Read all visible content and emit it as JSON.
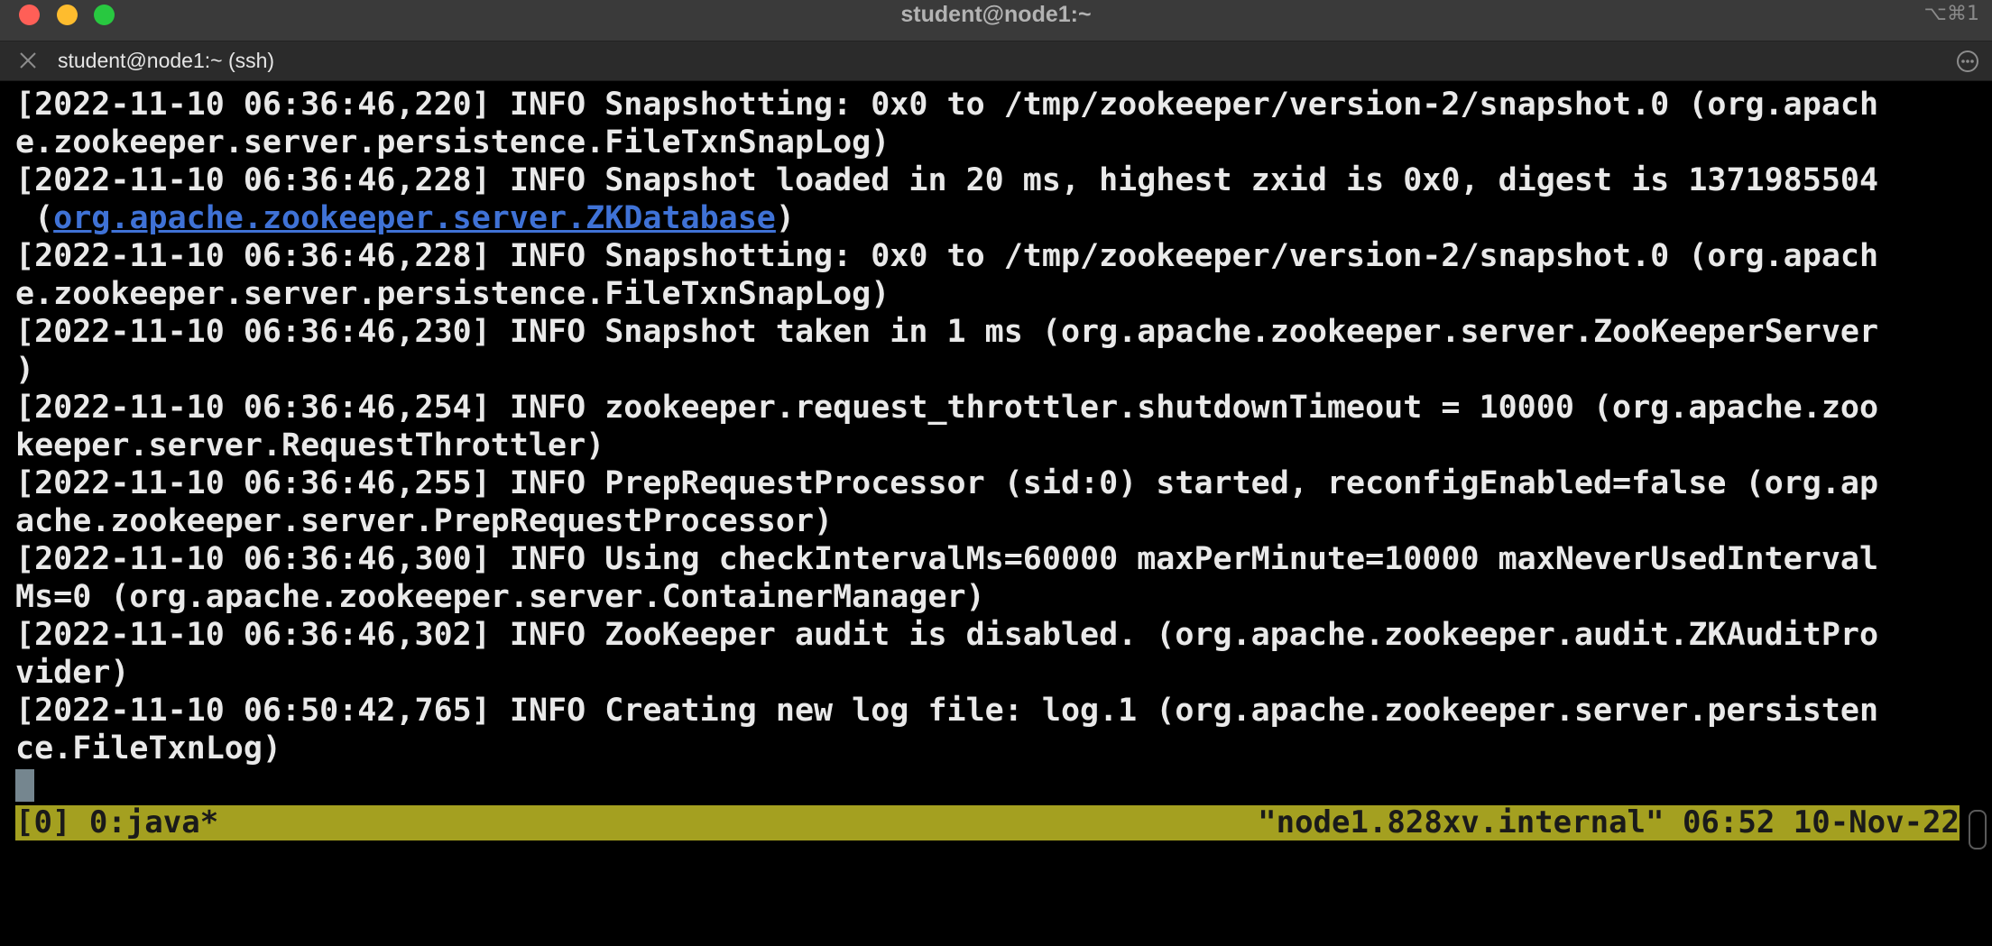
{
  "window": {
    "title": "student@node1:~",
    "shortcut": "⌥⌘1",
    "colors": {
      "close": "#ff5f57",
      "minimize": "#febc2e",
      "zoom": "#28c840",
      "status_bar": "#a4a020",
      "link": "#3f72d6"
    }
  },
  "tab": {
    "label": "student@node1:~ (ssh)",
    "close_icon": "close-icon",
    "menu_icon": "ellipsis-icon"
  },
  "terminal": {
    "lines": [
      "[2022-11-10 06:36:46,220] INFO Snapshotting: 0x0 to /tmp/zookeeper/version-2/snapshot.0 (org.apach",
      "e.zookeeper.server.persistence.FileTxnSnapLog)",
      "[2022-11-10 06:36:46,228] INFO Snapshot loaded in 20 ms, highest zxid is 0x0, digest is 1371985504",
      "",
      "[2022-11-10 06:36:46,228] INFO Snapshotting: 0x0 to /tmp/zookeeper/version-2/snapshot.0 (org.apach",
      "e.zookeeper.server.persistence.FileTxnSnapLog)",
      "[2022-11-10 06:36:46,230] INFO Snapshot taken in 1 ms (org.apache.zookeeper.server.ZooKeeperServer",
      ")",
      "[2022-11-10 06:36:46,254] INFO zookeeper.request_throttler.shutdownTimeout = 10000 (org.apache.zoo",
      "keeper.server.RequestThrottler)",
      "[2022-11-10 06:36:46,255] INFO PrepRequestProcessor (sid:0) started, reconfigEnabled=false (org.ap",
      "ache.zookeeper.server.PrepRequestProcessor)",
      "[2022-11-10 06:36:46,300] INFO Using checkIntervalMs=60000 maxPerMinute=10000 maxNeverUsedInterval",
      "Ms=0 (org.apache.zookeeper.server.ContainerManager)",
      "[2022-11-10 06:36:46,302] INFO ZooKeeper audit is disabled. (org.apache.zookeeper.audit.ZKAuditPro",
      "vider)",
      "[2022-11-10 06:50:42,765] INFO Creating new log file: log.1 (org.apache.zookeeper.server.persisten",
      "ce.FileTxnLog)"
    ],
    "link_line": {
      "prefix": " (",
      "link": "org.apache.zookeeper.server.ZKDatabase",
      "suffix": ")"
    }
  },
  "status_bar": {
    "left": "[0] 0:java*",
    "right": "\"node1.828xv.internal\" 06:52 10-Nov-22"
  }
}
